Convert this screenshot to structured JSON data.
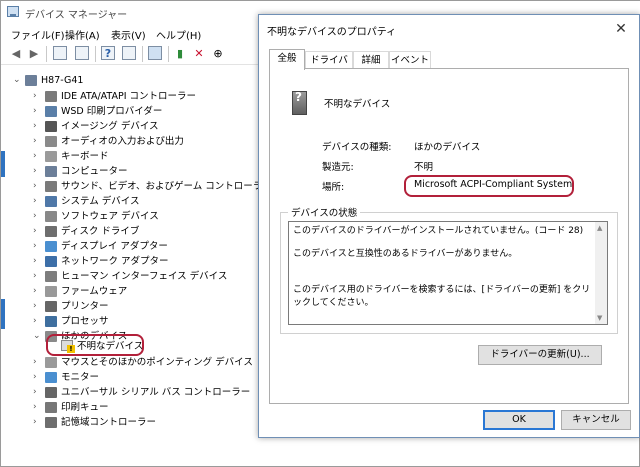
{
  "device_manager": {
    "title": "デバイス マネージャー",
    "menu": [
      "ファイル(F)",
      "操作(A)",
      "表示(V)",
      "ヘルプ(H)"
    ],
    "tree": {
      "root": "H87-G41",
      "categories": [
        "IDE ATA/ATAPI コントローラー",
        "WSD 印刷プロバイダー",
        "イメージング デバイス",
        "オーディオの入力および出力",
        "キーボード",
        "コンピューター",
        "サウンド、ビデオ、およびゲーム コントローラー",
        "システム デバイス",
        "ソフトウェア デバイス",
        "ディスク ドライブ",
        "ディスプレイ アダプター",
        "ネットワーク アダプター",
        "ヒューマン インターフェイス デバイス",
        "ファームウェア",
        "プリンター",
        "プロセッサ",
        "ほかのデバイス"
      ],
      "other_device_child": "不明なデバイス",
      "after_categories": [
        "マウスとそのほかのポインティング デバイス",
        "モニター",
        "ユニバーサル シリアル バス コントローラー",
        "印刷キュー",
        "記憶域コントローラー"
      ]
    }
  },
  "dialog": {
    "title": "不明なデバイスのプロパティ",
    "close_glyph": "✕",
    "tabs": [
      "全般",
      "ドライバー",
      "詳細",
      "イベント"
    ],
    "device_name": "不明なデバイス",
    "properties": {
      "type_label": "デバイスの種類:",
      "type_value": "ほかのデバイス",
      "manufacturer_label": "製造元:",
      "manufacturer_value": "不明",
      "location_label": "場所:",
      "location_value": "Microsoft ACPI-Compliant System"
    },
    "status_group_label": "デバイスの状態",
    "status_lines": [
      "このデバイスのドライバーがインストールされていません。(コード 28)",
      "このデバイスと互換性のあるドライバーがありません。",
      "このデバイス用のドライバーを検索するには、[ドライバーの更新] をクリックしてください。"
    ],
    "update_driver_button": "ドライバーの更新(U)...",
    "ok_button": "OK",
    "cancel_button": "キャンセル"
  },
  "colors": {
    "highlight_ring": "#b2203a",
    "dialog_border": "#6f8fb5",
    "focus_blue": "#2a77d4"
  }
}
